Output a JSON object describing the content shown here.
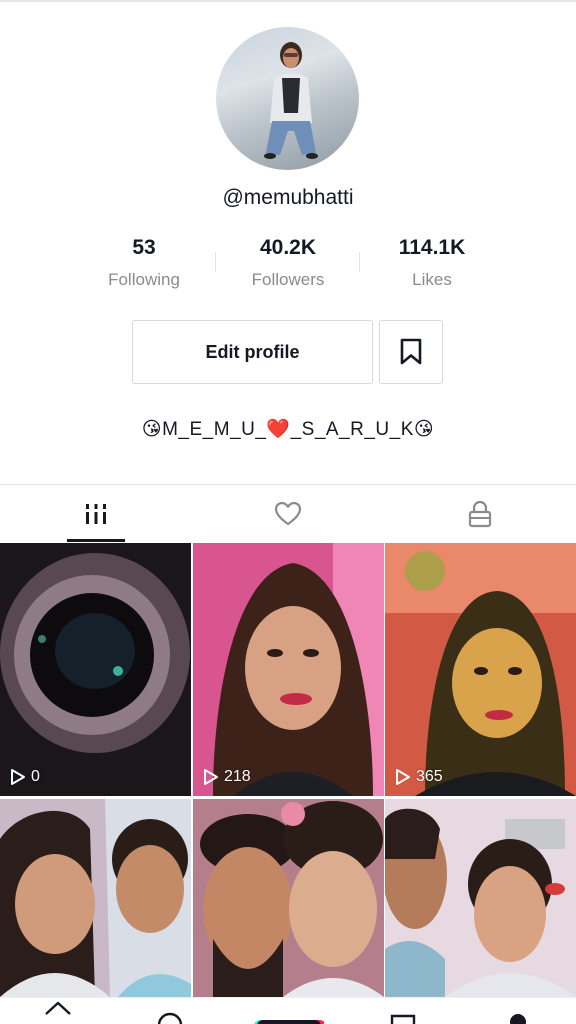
{
  "profile": {
    "username": "@memubhatti",
    "bio": "😘M_E_M_U_❤️_S_A_R_U_K😘"
  },
  "stats": [
    {
      "value": "53",
      "label": "Following"
    },
    {
      "value": "40.2K",
      "label": "Followers"
    },
    {
      "value": "114.1K",
      "label": "Likes"
    }
  ],
  "actions": {
    "edit_profile_label": "Edit profile",
    "bookmark_icon": "bookmark-icon"
  },
  "tabs": [
    {
      "icon": "videos-grid-icon",
      "active": true
    },
    {
      "icon": "heart-icon",
      "active": false
    },
    {
      "icon": "lock-icon",
      "active": false
    }
  ],
  "videos": [
    {
      "views": "0"
    },
    {
      "views": "218"
    },
    {
      "views": "365"
    },
    {
      "views": ""
    },
    {
      "views": ""
    },
    {
      "views": ""
    }
  ],
  "bottom_nav": [
    {
      "icon": "home-icon"
    },
    {
      "icon": "discover-icon"
    },
    {
      "icon": "create-icon"
    },
    {
      "icon": "inbox-icon"
    },
    {
      "icon": "profile-icon"
    }
  ],
  "colors": {
    "text": "#161823",
    "muted": "#8a8b91",
    "border": "#d7d7d9",
    "create_left": "#25f4ee",
    "create_right": "#fe2c55"
  }
}
